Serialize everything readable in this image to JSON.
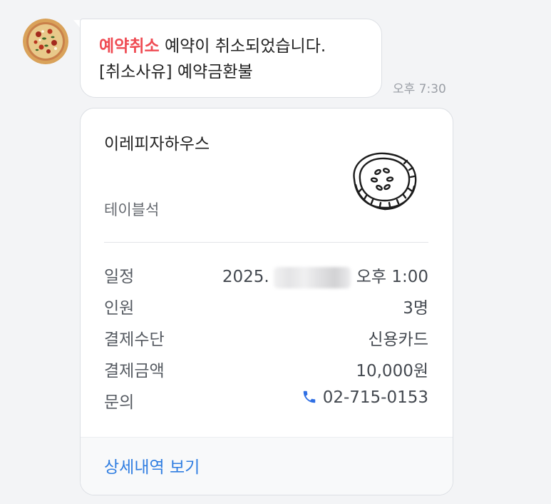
{
  "message": {
    "status_tag": "예약취소",
    "text_line1": "예약이 취소되었습니다.",
    "text_line2": "[취소사유] 예약금환불",
    "time": "오후 7:30"
  },
  "card": {
    "restaurant_name": "이레피자하우스",
    "seat_type": "테이블석",
    "rows": [
      {
        "label": "일정",
        "value_prefix": "2025.",
        "value_suffix": "오후 1:00"
      },
      {
        "label": "인원",
        "value": "3명"
      },
      {
        "label": "결제수단",
        "value": "신용카드"
      },
      {
        "label": "결제금액",
        "value": "10,000원"
      },
      {
        "label": "문의",
        "value": "02-715-0153"
      }
    ],
    "detail_link": "상세내역 보기"
  },
  "colors": {
    "status_red": "#ef4b53",
    "link_blue": "#2f7de1",
    "phone_blue": "#2f6fe4"
  },
  "icons": {
    "avatar": "pizza-avatar",
    "restaurant": "cucumber-slice-icon",
    "phone": "phone-icon"
  }
}
